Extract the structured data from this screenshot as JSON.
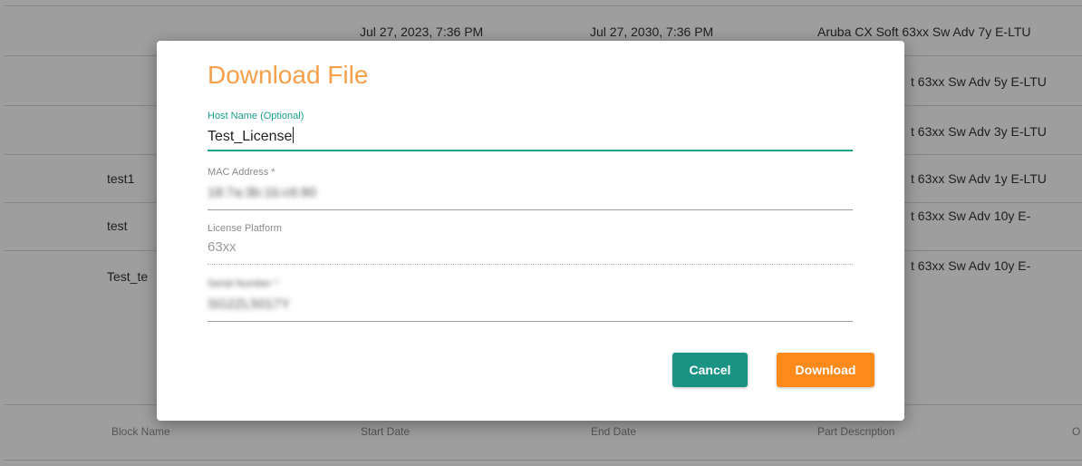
{
  "table": {
    "rows": [
      {
        "block_name": "",
        "start_date": "Jul 27, 2023, 7:36 PM",
        "end_date": "Jul 27, 2030, 7:36 PM",
        "part_description": "Aruba CX Soft 63xx Sw Adv 7y E-LTU"
      },
      {
        "block_name": "",
        "start_date": "",
        "end_date": "",
        "part_description": "t 63xx Sw Adv 5y E-LTU"
      },
      {
        "block_name": "",
        "start_date": "",
        "end_date": "",
        "part_description": "t 63xx Sw Adv 3y E-LTU"
      },
      {
        "block_name": "test1",
        "start_date": "",
        "end_date": "",
        "part_description": "t 63xx Sw Adv 1y E-LTU"
      },
      {
        "block_name": "test",
        "start_date": "",
        "end_date": "",
        "part_description": "t 63xx Sw Adv 10y E-"
      },
      {
        "block_name": "Test_te",
        "start_date": "",
        "end_date": "",
        "part_description": "t 63xx Sw Adv 10y E-"
      }
    ],
    "headers": {
      "block_name": "Block Name",
      "start_date": "Start Date",
      "end_date": "End Date",
      "part_description": "Part Description",
      "extra": "O"
    }
  },
  "modal": {
    "title": "Download File",
    "fields": {
      "host": {
        "label": "Host Name (Optional)",
        "value": "Test_License"
      },
      "mac": {
        "label": "MAC Address *",
        "value": "18:7a:3b:1b:c6:80"
      },
      "platform": {
        "label": "License Platform",
        "value": "63xx"
      },
      "serial": {
        "label": "Serial Number *",
        "value": "SG2ZL5017Y"
      }
    },
    "buttons": {
      "cancel": "Cancel",
      "download": "Download"
    }
  },
  "colors": {
    "title_orange": "#f5a04a",
    "teal_accent": "#1a9e8f",
    "cancel_teal": "#1a9384",
    "download_orange": "#ff8a1c"
  }
}
